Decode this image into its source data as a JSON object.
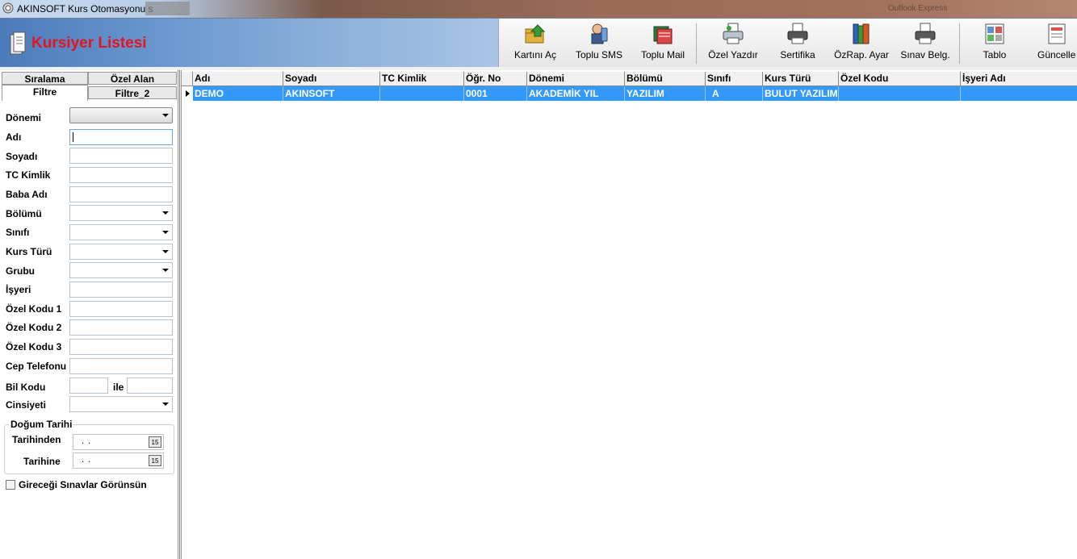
{
  "window": {
    "title": "AKINSOFT Kurs Otomasyonu s",
    "faint_right": "Outlook Express"
  },
  "header": {
    "title": "Kursiyer Listesi"
  },
  "toolbar": {
    "buttons": [
      {
        "label": "Kartını Aç",
        "icon": "open-card-icon"
      },
      {
        "label": "Toplu SMS",
        "icon": "sms-phone-icon"
      },
      {
        "label": "Toplu Mail",
        "icon": "mail-icon"
      },
      {
        "label": "Özel Yazdır",
        "icon": "special-print-icon"
      },
      {
        "label": "Sertifika",
        "icon": "certificate-printer-icon"
      },
      {
        "label": "ÖzRap. Ayar",
        "icon": "report-books-icon"
      },
      {
        "label": "Sınav Belg.",
        "icon": "exam-doc-printer-icon"
      },
      {
        "label": "Tablo",
        "icon": "table-icon"
      },
      {
        "label": "Güncelle",
        "icon": "refresh-icon"
      }
    ]
  },
  "left_panel": {
    "tabs": {
      "siralama": "Sıralama",
      "ozel_alan": "Özel Alan",
      "filtre": "Filtre",
      "filtre_2": "Filtre_2"
    },
    "fields": {
      "donemi": "Dönemi",
      "adi": "Adı",
      "soyadi": "Soyadı",
      "tc_kimlik": "TC Kimlik",
      "baba_adi": "Baba Adı",
      "bolumu": "Bölümü",
      "sinifi": "Sınıfı",
      "kurs_turu": "Kurs Türü",
      "grubu": "Grubu",
      "isyeri": "İşyeri",
      "ozel_kodu_1": "Özel Kodu 1",
      "ozel_kodu_2": "Özel Kodu 2",
      "ozel_kodu_3": "Özel Kodu 3",
      "cep_telefonu": "Cep Telefonu",
      "bil_kodu": "Bil Kodu",
      "ile": "ile",
      "cinsiyeti": "Cinsiyeti"
    },
    "birth_group": {
      "title": "Doğum Tarihi",
      "from_label": "Tarihinden",
      "to_label": "Tarihine",
      "from_value": ".   .",
      "to_value": ".   .",
      "cal_glyph": "15"
    },
    "checkbox_label": "Gireceği Sınavlar Görünsün"
  },
  "grid": {
    "columns": [
      "Adı",
      "Soyadı",
      "TC Kimlik",
      "Öğr. No",
      "Dönemi",
      "Bölümü",
      "Sınıfı",
      "Kurs Türü",
      "Özel Kodu",
      "İşyeri Adı"
    ],
    "rows": [
      [
        "DEMO",
        "AKINSOFT",
        "",
        "0001",
        "AKADEMİK YIL",
        "YAZILIM",
        "A",
        "BULUT YAZILIM",
        "",
        ""
      ]
    ]
  },
  "colors": {
    "selection": "#3399ff",
    "title_red": "#e4141e",
    "header_blue": "#4b7bbb"
  }
}
